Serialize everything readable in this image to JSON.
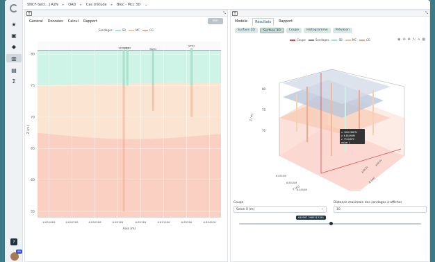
{
  "breadcrumb": {
    "project": "SNCF-Sect...] A2N",
    "module": "OAD",
    "study": "Cas d'étude",
    "model": "Bloc - Mcc 3D"
  },
  "sidebar": {
    "icons": [
      "home-icon",
      "star-icon",
      "map-icon",
      "layers-icon",
      "chart-icon",
      "table-icon",
      "sum-icon"
    ],
    "active_index": 4,
    "help_label": "?",
    "notification_count": "99"
  },
  "left_panel": {
    "tabs": [
      "Général",
      "Données",
      "Calcul",
      "Rapport"
    ],
    "run_label": "Voir",
    "legend_title": "Sondages",
    "legend_items": [
      {
        "name": "SB",
        "color": "#9be7d2"
      },
      {
        "name": "MC",
        "color": "#f6c19d"
      },
      {
        "name": "CG",
        "color": "#f5a58d"
      }
    ]
  },
  "chart_data": {
    "type": "area",
    "title": "",
    "xlabel": "Axis (m)",
    "ylabel": "Z (m)",
    "x_ticks": [
      "6.8518E6",
      "6.8502E6",
      "6.8505E6",
      "6.851E6",
      "6.851E6",
      "6.8515E6",
      "6.852E6",
      "6.8545E6"
    ],
    "y_ticks": [
      "80",
      "75",
      "70",
      "65",
      "60",
      "55"
    ],
    "ylim": [
      54,
      82
    ],
    "bands": [
      {
        "name": "SB",
        "top": 80.5,
        "bottom": 75.0,
        "color": "#c9f3e5"
      },
      {
        "name": "MC",
        "top": 75.0,
        "bottom": 67.5,
        "color": "#fbe1cc"
      },
      {
        "name": "CG",
        "top": 67.5,
        "bottom": 54.0,
        "color": "#f9cbbb"
      }
    ],
    "boreholes": [
      {
        "label": "SD0B02",
        "x": 0.47,
        "top": 80.7,
        "bottom": 55.0
      },
      {
        "label": "SD02",
        "x": 0.49,
        "top": 80.7,
        "bottom": 76.0
      },
      {
        "label": "SD01",
        "x": 0.63,
        "top": 80.5,
        "bottom": 71.0
      },
      {
        "label": "SP02",
        "x": 0.84,
        "top": 81.0,
        "bottom": 70.0
      }
    ],
    "grid": true
  },
  "right_panel": {
    "tabs": [
      "Modèle",
      "Résultats",
      "Rapport"
    ],
    "active_tab": 1,
    "subtabs": [
      "Surface 2D",
      "Surface 3D",
      "Coupe",
      "Histogramme",
      "Prévision"
    ],
    "active_subtab": 1,
    "legend": [
      {
        "name": "Coupe",
        "color": "#e04a4a"
      },
      {
        "name": "Sondages",
        "color": "#888888"
      },
      {
        "name": "SB",
        "color": "#9be7d2"
      },
      {
        "name": "MC",
        "color": "#f6c19d"
      },
      {
        "name": "CG",
        "color": "#f5a58d"
      }
    ],
    "tooltip": [
      "x: 1640.9887k",
      "y: 6.85494M",
      "z: 75.64672",
      "value: 1"
    ],
    "axis_labels": {
      "z": "Z (m)",
      "y": "Y (m)",
      "x": "X (m)"
    },
    "coupe_label": "Coupe",
    "coupe_value": "Selon X (m)",
    "distance_label": "Distance maximale des sondages à afficher",
    "distance_value": "10",
    "slider_value": "648567.3985513184",
    "slider_position": 0.5
  }
}
